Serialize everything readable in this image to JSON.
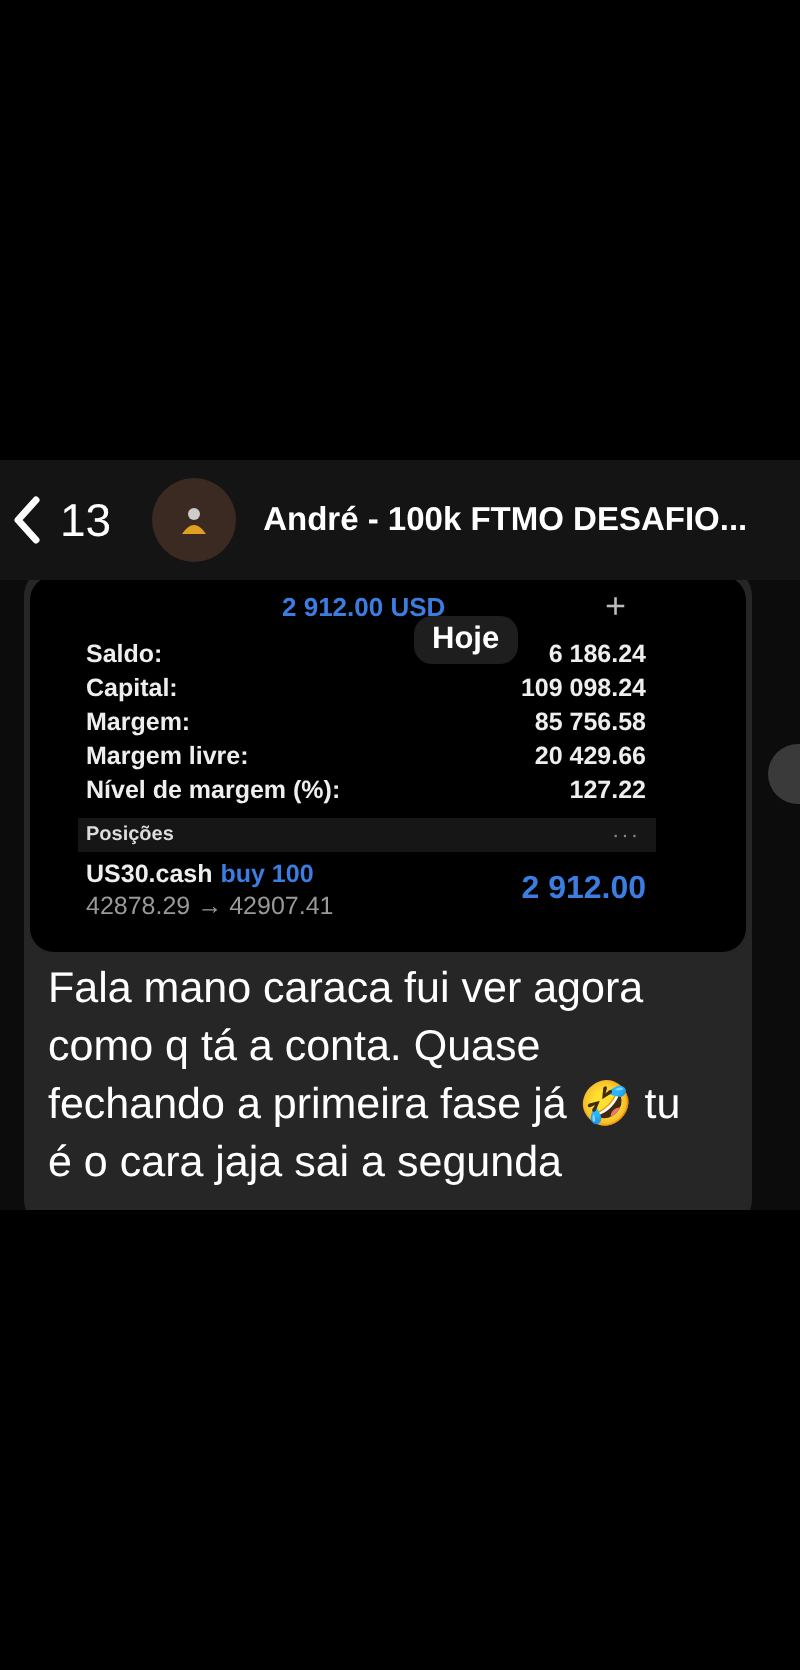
{
  "header": {
    "back_label": "13",
    "title": "André - 100k FTMO DESAFIO..."
  },
  "message": {
    "screenshot": {
      "total": "2 912.00 USD",
      "plus": "+",
      "date_badge": "Hoje",
      "rows": [
        {
          "label": "Saldo:",
          "value": "6 186.24"
        },
        {
          "label": "Capital:",
          "value": "109 098.24"
        },
        {
          "label": "Margem:",
          "value": "85 756.58"
        },
        {
          "label": "Margem livre:",
          "value": "20 429.66"
        },
        {
          "label": "Nível de margem (%):",
          "value": "127.22"
        }
      ],
      "positions_title": "Posições",
      "positions_menu": "···",
      "position": {
        "symbol": "US30.cash",
        "side": "buy 100",
        "prices": "42878.29 → 42907.41",
        "profit": "2 912.00"
      }
    },
    "text": "Fala mano caraca fui ver agora como q tá a conta. Quase fechando a primeira fase já 🤣 tu é o cara jaja sai a segunda"
  }
}
